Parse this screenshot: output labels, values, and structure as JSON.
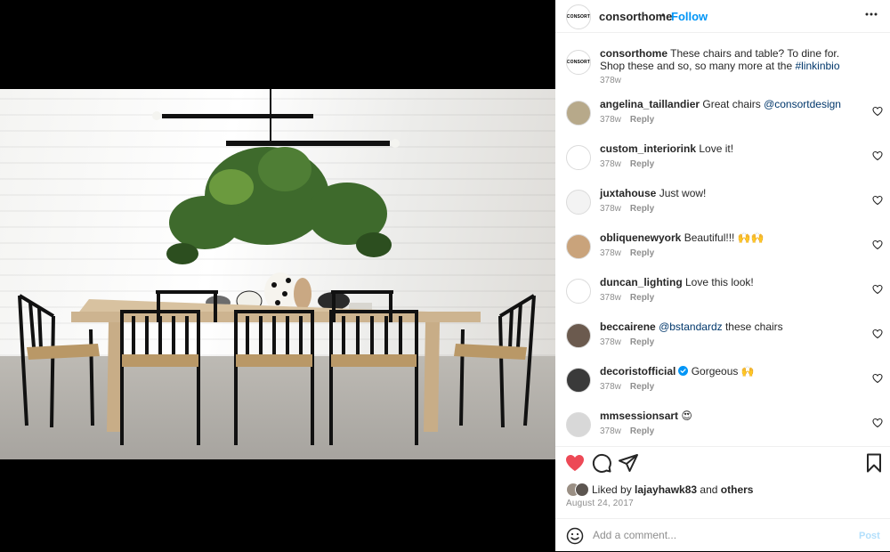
{
  "header": {
    "brand_logo_text": "CONSORT",
    "username": "consorthome",
    "separator": "•",
    "follow_label": "Follow",
    "more_icon": "more-dots-icon"
  },
  "caption": {
    "username": "consorthome",
    "text": " These chairs and table? To dine for. Shop these and so, so many more at the ",
    "hashtag": "#linkinbio",
    "time": "378w"
  },
  "comments": [
    {
      "username": "angelina_taillandier",
      "pre": " Great chairs ",
      "mention": "@consortdesign",
      "post": "",
      "time": "378w",
      "reply": "Reply",
      "avatar_color": "#b7a98a"
    },
    {
      "username": "custom_interiorink",
      "pre": " Love it!",
      "mention": "",
      "post": "",
      "time": "378w",
      "reply": "Reply",
      "avatar_color": "#ffffff"
    },
    {
      "username": "juxtahouse",
      "pre": " Just wow!",
      "mention": "",
      "post": "",
      "time": "378w",
      "reply": "Reply",
      "avatar_color": "#f3f3f3"
    },
    {
      "username": "obliquenewyork",
      "pre": " Beautiful!!! 🙌🙌",
      "mention": "",
      "post": "",
      "time": "378w",
      "reply": "Reply",
      "avatar_color": "#c9a37b"
    },
    {
      "username": "duncan_lighting",
      "pre": " Love this look!",
      "mention": "",
      "post": "",
      "time": "378w",
      "reply": "Reply",
      "avatar_color": "#ffffff"
    },
    {
      "username": "beccairene",
      "pre": " ",
      "mention": "@bstandardz",
      "post": " these chairs",
      "time": "378w",
      "reply": "Reply",
      "avatar_color": "#6b5a4e"
    },
    {
      "username": "decoristofficial",
      "pre": " Gorgeous 🙌",
      "mention": "",
      "post": "",
      "time": "378w",
      "reply": "Reply",
      "avatar_color": "#3a3a3a",
      "verified": true
    },
    {
      "username": "mmsessionsart",
      "pre": " 😍",
      "mention": "",
      "post": "",
      "time": "378w",
      "reply": "Reply",
      "avatar_color": "#d8d8d8"
    }
  ],
  "likes": {
    "prefix": "Liked by ",
    "user": "lajayhawk83",
    "middle": " and ",
    "others": "others"
  },
  "date": "August 24, 2017",
  "add_comment": {
    "placeholder": "Add a comment...",
    "post_label": "Post"
  },
  "colors": {
    "accent": "#0095f6",
    "like_red": "#ed4956",
    "link": "#00376b",
    "muted": "#8e8e8e"
  }
}
